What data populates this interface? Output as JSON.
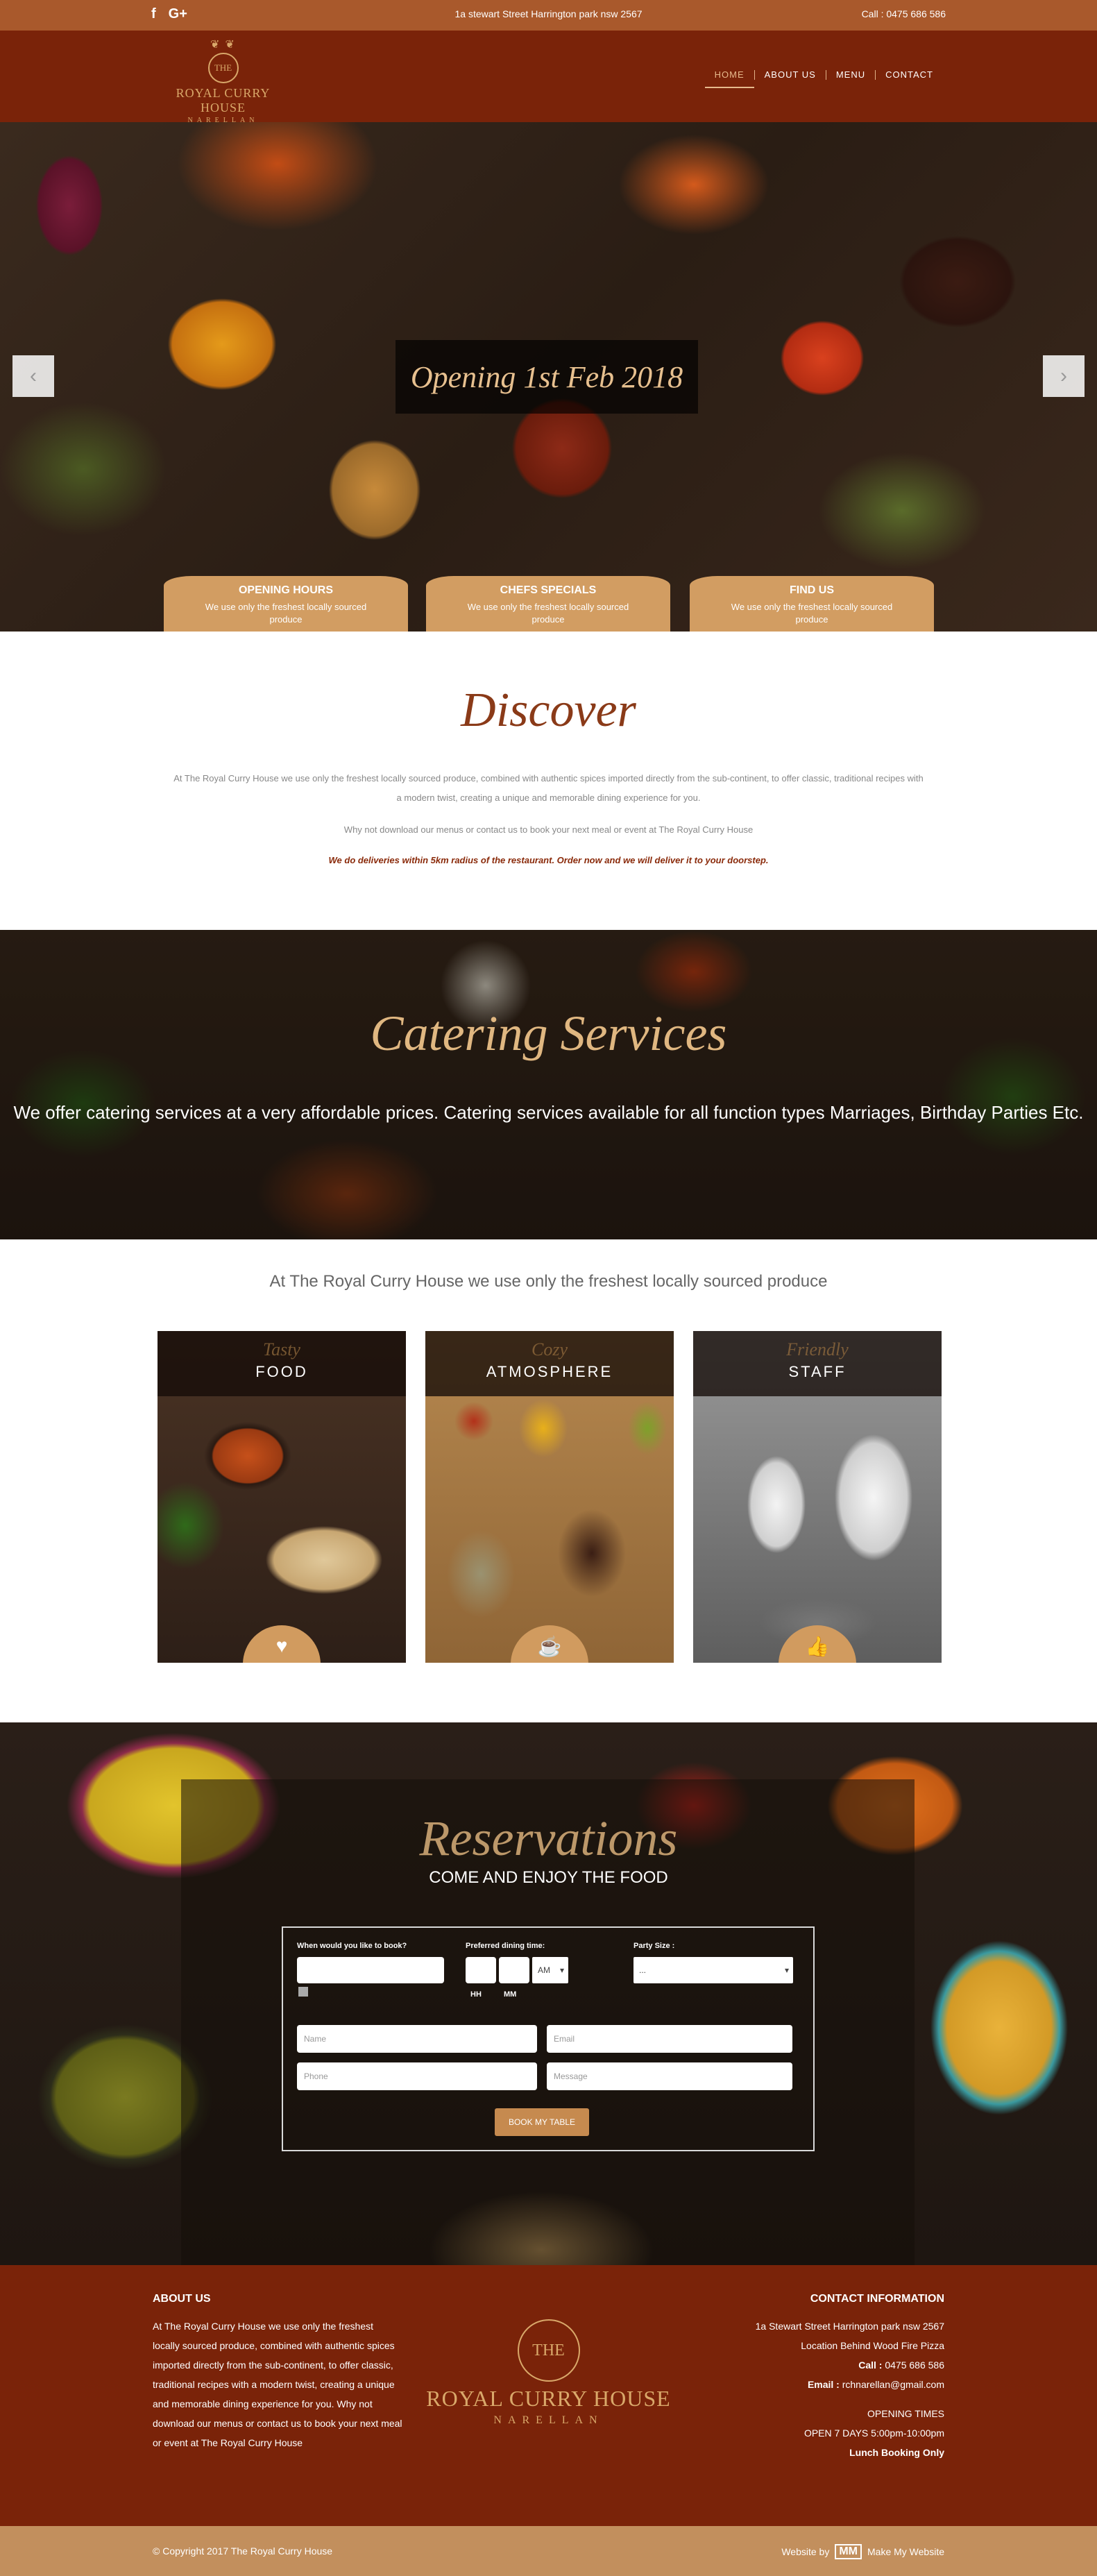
{
  "topbar": {
    "social": [
      "f",
      "G+"
    ],
    "address": "1a stewart Street Harrington park nsw 2567",
    "call": "Call : 0475 686 586"
  },
  "logo": {
    "ring": "THE",
    "name": "ROYAL CURRY HOUSE",
    "sub": "NARELLAN"
  },
  "nav": [
    "HOME",
    "ABOUT US",
    "MENU",
    "CONTACT"
  ],
  "hero": {
    "caption": "Opening 1st Feb 2018",
    "prev": "‹",
    "next": "›",
    "tabs": [
      {
        "title": "OPENING HOURS",
        "desc": "We use only the freshest locally sourced produce"
      },
      {
        "title": "CHEFS SPECIALS",
        "desc": "We use only the freshest locally sourced produce"
      },
      {
        "title": "FIND US",
        "desc": "We use only the freshest locally sourced produce"
      }
    ]
  },
  "discover": {
    "title": "Discover",
    "p1": "At The Royal Curry House we use only the freshest locally sourced produce, combined with authentic spices imported directly from the sub-continent, to offer classic, traditional recipes with a modern twist, creating a unique and memorable dining experience for you.",
    "p2": "Why not download our menus or contact us to book your next meal or event at The Royal Curry House",
    "p3": "We do deliveries within 5km radius of the restaurant. Order now and we will deliver it to your doorstep."
  },
  "catering": {
    "title": "Catering Services",
    "text": "We offer catering services at a very affordable prices. Catering services available for all function types Marriages, Birthday Parties Etc."
  },
  "produce": {
    "title": "At The Royal Curry House we use only the freshest locally sourced produce",
    "cards": [
      {
        "script": "Tasty",
        "label": "FOOD",
        "icon": "heart-icon",
        "glyph": "♥"
      },
      {
        "script": "Cozy",
        "label": "ATMOSPHERE",
        "icon": "coffee-cup-icon",
        "glyph": "☕"
      },
      {
        "script": "Friendly",
        "label": "STAFF",
        "icon": "thumbs-up-icon",
        "glyph": "👍"
      }
    ]
  },
  "reservations": {
    "title": "Reservations",
    "subtitle": "COME AND ENJOY THE FOOD",
    "label_date": "When would you like to book?",
    "label_time": "Preferred dining time:",
    "label_party": "Party Size :",
    "ampm": "AM",
    "hh": "HH",
    "mm": "MM",
    "party_value": "...",
    "name_placeholder": "Name",
    "email_placeholder": "Email",
    "phone_placeholder": "Phone",
    "message_placeholder": "Message",
    "button": "BOOK MY TABLE"
  },
  "footer": {
    "about_title": "ABOUT US",
    "about_text": "At The Royal Curry House we use only the freshest locally sourced produce, combined with authentic spices imported directly from the sub-continent, to offer classic, traditional recipes with a modern twist, creating a unique and memorable dining experience for you. Why not download our menus or contact us to book your next meal or event at The Royal Curry House",
    "contact_title": "CONTACT INFORMATION",
    "contact_address": "1a Stewart Street Harrington park nsw 2567",
    "contact_location": "Location Behind Wood Fire Pizza",
    "contact_call_label": "Call :",
    "contact_call": " 0475 686 586",
    "contact_email_label": "Email :",
    "contact_email": " rchnarellan@gmail.com",
    "hours_title": "OPENING TIMES",
    "hours": "OPEN 7 DAYS 5:00pm-10:00pm",
    "lunch": "Lunch Booking Only",
    "copyright": "© Copyright 2017 The Royal Curry House",
    "credit_prefix": "Website by",
    "credit_mark": "MM",
    "credit_name": "Make My Website"
  }
}
